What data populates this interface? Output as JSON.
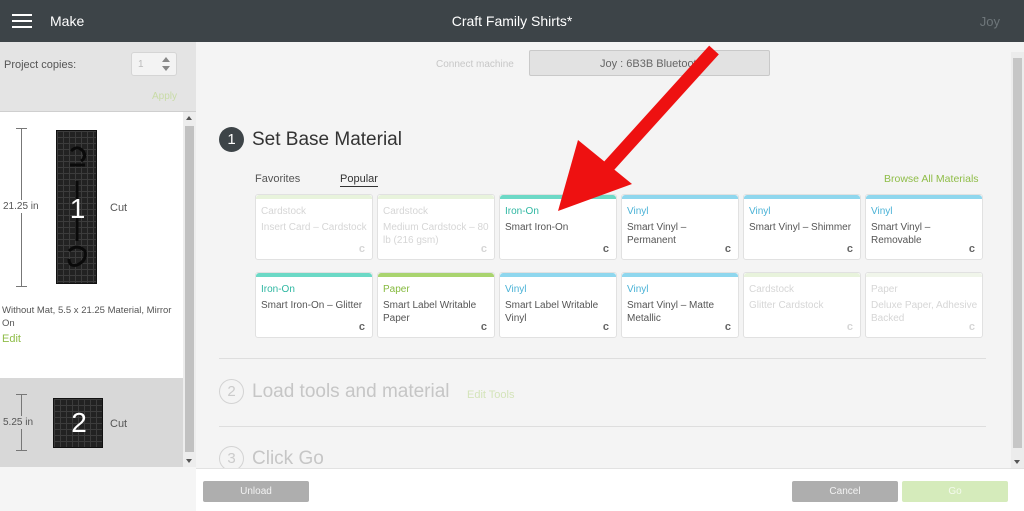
{
  "header": {
    "menu_icon": "hamburger-menu-icon",
    "section": "Make",
    "title": "Craft Family Shirts*",
    "user": "Joy"
  },
  "sidebar": {
    "copies_label": "Project copies:",
    "copies_value": "1",
    "apply_label": "Apply",
    "mats": [
      {
        "number": "1",
        "dimension": "21.25 in",
        "action": "Cut",
        "info": "Without Mat, 5.5 x 21.25 Material, Mirror On",
        "edit_label": "Edit"
      },
      {
        "number": "2",
        "dimension": "5.25 in",
        "action": "Cut"
      }
    ]
  },
  "main": {
    "connect_label": "Connect machine",
    "machine": "Joy : 6B3B Bluetooth",
    "steps": [
      {
        "number": "1",
        "title": "Set Base Material"
      },
      {
        "number": "2",
        "title": "Load tools and material",
        "link": "Edit Tools"
      },
      {
        "number": "3",
        "title": "Click Go"
      }
    ],
    "tabs": {
      "favorites": "Favorites",
      "popular": "Popular"
    },
    "browse_all": "Browse All Materials",
    "materials": [
      {
        "category": "Cardstock",
        "name": "Insert Card – Cardstock",
        "icon": "cricut-c-icon",
        "state": "disabled"
      },
      {
        "category": "Cardstock",
        "name": "Medium Cardstock – 80 lb (216 gsm)",
        "icon": "cricut-c-icon",
        "state": "disabled"
      },
      {
        "category": "Iron-On",
        "name": "Smart Iron-On",
        "icon": "cricut-c-icon",
        "state": "enabled"
      },
      {
        "category": "Vinyl",
        "name": "Smart Vinyl – Permanent",
        "icon": "cricut-c-icon",
        "state": "enabled"
      },
      {
        "category": "Vinyl",
        "name": "Smart Vinyl – Shimmer",
        "icon": "cricut-c-icon",
        "state": "enabled"
      },
      {
        "category": "Vinyl",
        "name": "Smart Vinyl – Removable",
        "icon": "cricut-c-icon",
        "state": "enabled"
      },
      {
        "category": "Iron-On",
        "name": "Smart Iron-On – Glitter",
        "icon": "cricut-c-icon",
        "state": "enabled"
      },
      {
        "category": "Paper",
        "name": "Smart Label Writable Paper",
        "icon": "cricut-c-icon",
        "state": "enabled"
      },
      {
        "category": "Vinyl",
        "name": "Smart Label Writable Vinyl",
        "icon": "cricut-c-icon",
        "state": "enabled"
      },
      {
        "category": "Vinyl",
        "name": "Smart Vinyl – Matte Metallic",
        "icon": "cricut-c-icon",
        "state": "enabled"
      },
      {
        "category": "Cardstock",
        "name": "Glitter Cardstock",
        "icon": "cricut-c-icon",
        "state": "disabled"
      },
      {
        "category": "Paper",
        "name": "Deluxe Paper, Adhesive Backed",
        "icon": "cricut-c-icon",
        "state": "disabled"
      }
    ],
    "cricut_glyph": "c"
  },
  "footer": {
    "unload": "Unload",
    "cancel": "Cancel",
    "go": "Go"
  },
  "annotation": {
    "icon": "red-arrow-icon",
    "color": "#ee1111"
  },
  "colors": {
    "header_bg": "#3d4448",
    "accent_green": "#8fbd48",
    "iron_on": "#2fb7a2",
    "vinyl": "#4ab2d6",
    "paper": "#86ba3f"
  }
}
